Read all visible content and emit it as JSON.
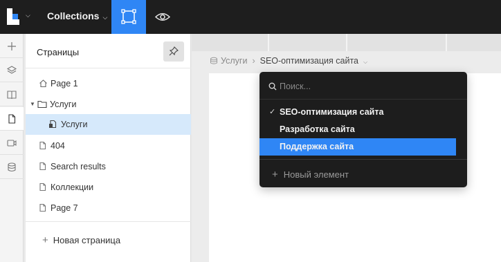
{
  "topbar": {
    "logo": "tilda-logo-icon",
    "logo_menu": "chevron-down-icon",
    "collections_label": "Collections",
    "tools": [
      "select-frame-icon",
      "eye-icon"
    ],
    "accent_color": "#2f86f5"
  },
  "left_rail": {
    "buttons": [
      "plus-icon",
      "layers-icon",
      "book-icon",
      "page-icon",
      "video-icon",
      "database-icon"
    ],
    "active": "page-icon"
  },
  "pages_panel": {
    "title": "Страницы",
    "pin_icon": "pin-icon",
    "items": [
      {
        "label": "Page 1",
        "icon": "home-icon"
      },
      {
        "label": "Услуги",
        "icon": "folder-icon",
        "expanded": true
      },
      {
        "label": "Услуги",
        "icon": "collection-page-icon",
        "selected": true
      },
      {
        "label": "404",
        "icon": "page-icon"
      },
      {
        "label": "Search results",
        "icon": "page-icon"
      },
      {
        "label": "Коллекции",
        "icon": "page-icon"
      },
      {
        "label": "Page 7",
        "icon": "page-icon"
      }
    ],
    "new_page_label": "Новая страница"
  },
  "breadcrumb": {
    "parent": "Услуги",
    "current": "SEO-оптимизация сайта"
  },
  "dropdown": {
    "search_placeholder": "Поиск...",
    "items": [
      {
        "label": "SEO-оптимизация сайта",
        "checked": true
      },
      {
        "label": "Разработка сайта"
      },
      {
        "label": "Поддержка сайта",
        "highlighted": true
      }
    ],
    "new_item_label": "Новый элемент",
    "highlight_color": "#2f86f5"
  }
}
